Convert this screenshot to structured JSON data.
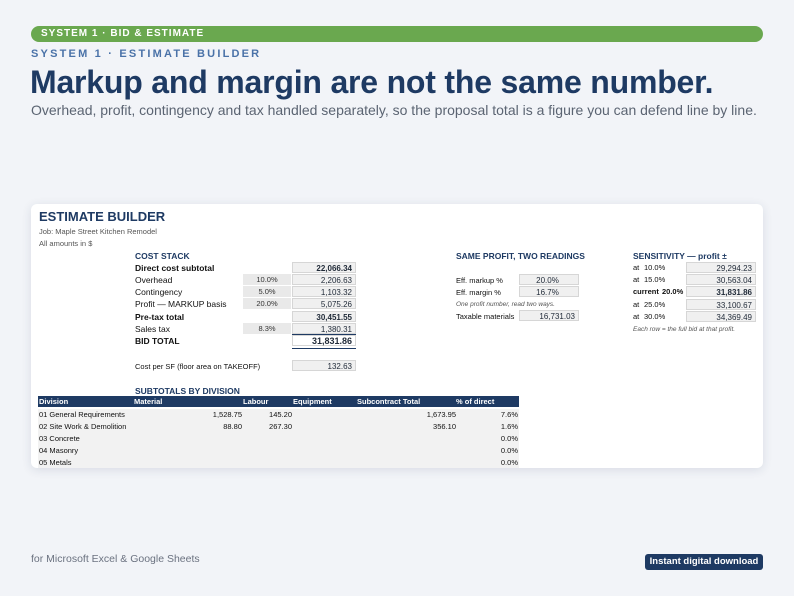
{
  "banner": {
    "pill": "SYSTEM 1 · BID & ESTIMATE",
    "kicker": "SYSTEM 1 · ESTIMATE BUILDER",
    "headline": "Markup and margin are not the same number.",
    "subtitle": "Overhead, profit, contingency and tax handled separately, so the proposal total is a figure you can defend line by line."
  },
  "sheet": {
    "title": "ESTIMATE BUILDER",
    "job": "Job: Maple Street Kitchen Remodel",
    "units_note": "All amounts in $",
    "cost_stack": {
      "heading": "COST STACK",
      "rows": [
        {
          "label": "Direct cost subtotal",
          "pct": "",
          "value": "22,066.34",
          "bold": true
        },
        {
          "label": "Overhead",
          "pct": "10.0%",
          "value": "2,206.63",
          "bold": false
        },
        {
          "label": "Contingency",
          "pct": "5.0%",
          "value": "1,103.32",
          "bold": false
        },
        {
          "label": "Profit — MARKUP basis",
          "pct": "20.0%",
          "value": "5,075.26",
          "bold": false
        },
        {
          "label": "Pre-tax total",
          "pct": "",
          "value": "30,451.55",
          "bold": true
        },
        {
          "label": "Sales tax",
          "pct": "8.3%",
          "value": "1,380.31",
          "bold": false
        },
        {
          "label": "BID TOTAL",
          "pct": "",
          "value": "31,831.86",
          "bold": true
        }
      ],
      "cost_per_sf_label": "Cost per SF (floor area on TAKEOFF)",
      "cost_per_sf_value": "132.63"
    },
    "readings": {
      "heading": "SAME PROFIT, TWO READINGS",
      "eff_markup_label": "Eff. markup %",
      "eff_markup_value": "20.0%",
      "eff_margin_label": "Eff. margin %",
      "eff_margin_value": "16.7%",
      "note": "One profit number, read two ways.",
      "taxable_label": "Taxable materials",
      "taxable_value": "16,731.03"
    },
    "sensitivity": {
      "heading": "SENSITIVITY — profit ±",
      "rows": [
        {
          "label": "at",
          "pct": "10.0%",
          "value": "29,294.23",
          "bold": false
        },
        {
          "label": "at",
          "pct": "15.0%",
          "value": "30,563.04",
          "bold": false
        },
        {
          "label": "current",
          "pct": "20.0%",
          "value": "31,831.86",
          "bold": true
        },
        {
          "label": "at",
          "pct": "25.0%",
          "value": "33,100.67",
          "bold": false
        },
        {
          "label": "at",
          "pct": "30.0%",
          "value": "34,369.49",
          "bold": false
        }
      ],
      "note": "Each row = the full bid at that profit."
    },
    "subtotals": {
      "heading": "SUBTOTALS BY DIVISION",
      "columns": [
        "Division",
        "Material",
        "Labour",
        "Equipment",
        "Subcontract Total",
        "% of direct"
      ],
      "rows": [
        {
          "division": "01 General Requirements",
          "material": "1,528.75",
          "labour": "145.20",
          "equipment": "",
          "subtotal": "1,673.95",
          "pct": "7.6%"
        },
        {
          "division": "02 Site Work & Demolition",
          "material": "88.80",
          "labour": "267.30",
          "equipment": "",
          "subtotal": "356.10",
          "pct": "1.6%"
        },
        {
          "division": "03 Concrete",
          "material": "",
          "labour": "",
          "equipment": "",
          "subtotal": "",
          "pct": "0.0%"
        },
        {
          "division": "04 Masonry",
          "material": "",
          "labour": "",
          "equipment": "",
          "subtotal": "",
          "pct": "0.0%"
        },
        {
          "division": "05 Metals",
          "material": "",
          "labour": "",
          "equipment": "",
          "subtotal": "",
          "pct": "0.0%"
        }
      ]
    }
  },
  "footer": {
    "left": "for Microsoft Excel & Google Sheets",
    "badge": "Instant digital download"
  },
  "colors": {
    "accent_green": "#6aa84f",
    "navy": "#1e3a63",
    "kicker_blue": "#4a72a8"
  }
}
